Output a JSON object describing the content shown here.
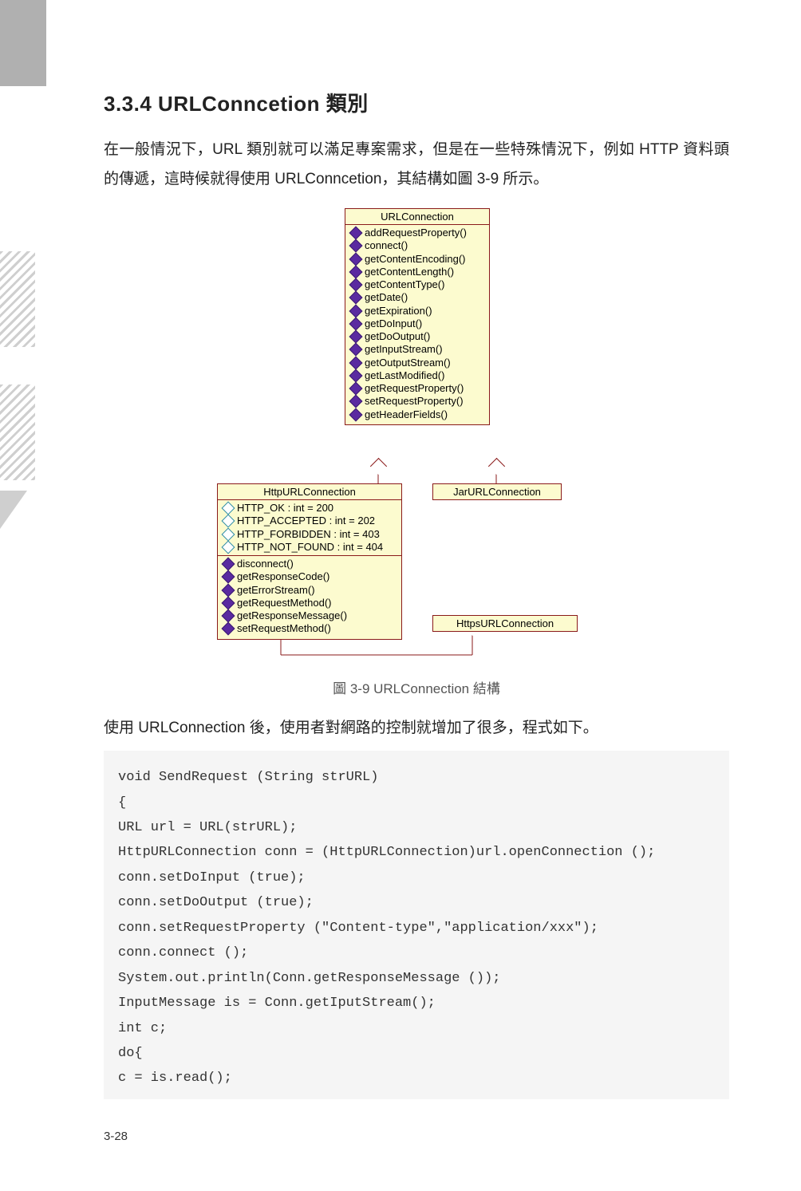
{
  "section_heading": "3.3.4  URLConncetion 類別",
  "intro_p1": "在一般情況下，URL 類別就可以滿足專案需求，但是在一些特殊情況下，例如 HTTP 資料頭的傳遞，這時候就得使用 URLConncetion，其結構如圖 3-9 所示。",
  "uml": {
    "base": {
      "title": "URLConnection",
      "methods": [
        "addRequestProperty()",
        "connect()",
        "getContentEncoding()",
        "getContentLength()",
        "getContentType()",
        "getDate()",
        "getExpiration()",
        "getDoInput()",
        "getDoOutput()",
        "getInputStream()",
        "getOutputStream()",
        "getLastModified()",
        "getRequestProperty()",
        "setRequestProperty()",
        "getHeaderFields()"
      ]
    },
    "http": {
      "title": "HttpURLConnection",
      "attrs": [
        "HTTP_OK : int = 200",
        "HTTP_ACCEPTED : int = 202",
        "HTTP_FORBIDDEN : int = 403",
        "HTTP_NOT_FOUND : int = 404"
      ],
      "methods": [
        "disconnect()",
        "getResponseCode()",
        "getErrorStream()",
        "getRequestMethod()",
        "getResponseMessage()",
        "setRequestMethod()"
      ]
    },
    "jar": {
      "title": "JarURLConnection"
    },
    "https": {
      "title": "HttpsURLConnection"
    }
  },
  "figure_caption": "圖 3-9  URLConnection 結構",
  "after_p": "使用 URLConnection 後，使用者對網路的控制就增加了很多，程式如下。",
  "code": "void SendRequest (String strURL)\n{\nURL url = URL(strURL);\nHttpURLConnection conn = (HttpURLConnection)url.openConnection ();\nconn.setDoInput (true);\nconn.setDoOutput (true);\nconn.setRequestProperty (\"Content-type\",\"application/xxx\");\nconn.connect ();\nSystem.out.println(Conn.getResponseMessage ());\nInputMessage is = Conn.getIputStream();\nint c;\ndo{\nc = is.read();",
  "page_number": "3-28"
}
